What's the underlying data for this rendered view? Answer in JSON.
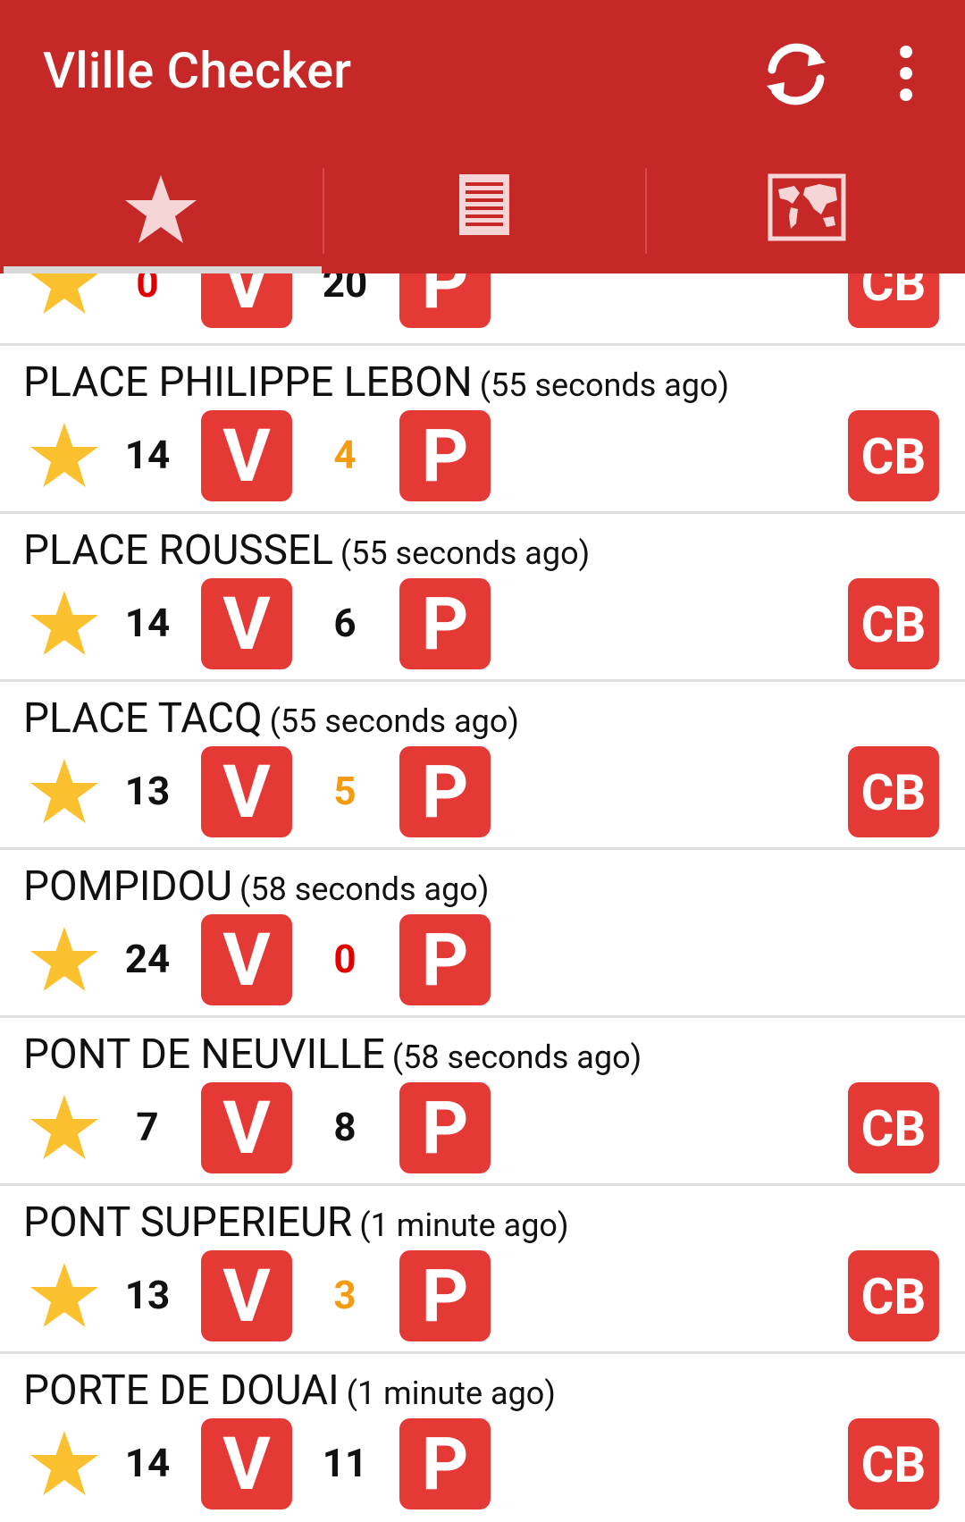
{
  "app": {
    "title": "Vlille Checker"
  },
  "toolbar": {
    "refresh_icon": "refresh-icon",
    "menu_icon": "more-vert-icon"
  },
  "tabs": [
    {
      "icon": "star-icon",
      "selected": true
    },
    {
      "icon": "list-icon",
      "selected": false
    },
    {
      "icon": "map-icon",
      "selected": false
    }
  ],
  "partial_row": {
    "bikes": "0",
    "stands": "20",
    "has_cb": true
  },
  "stations": [
    {
      "name": "PLACE PHILIPPE LEBON",
      "ago": "(55 seconds ago)",
      "bikes": "14",
      "stands": "4",
      "has_cb": true
    },
    {
      "name": "PLACE ROUSSEL",
      "ago": "(55 seconds ago)",
      "bikes": "14",
      "stands": "6",
      "has_cb": true
    },
    {
      "name": "PLACE TACQ",
      "ago": "(55 seconds ago)",
      "bikes": "13",
      "stands": "5",
      "has_cb": true
    },
    {
      "name": "POMPIDOU",
      "ago": "(58 seconds ago)",
      "bikes": "24",
      "stands": "0",
      "has_cb": false
    },
    {
      "name": "PONT DE NEUVILLE",
      "ago": "(58 seconds ago)",
      "bikes": "7",
      "stands": "8",
      "has_cb": true
    },
    {
      "name": "PONT SUPERIEUR",
      "ago": "(1 minute ago)",
      "bikes": "13",
      "stands": "3",
      "has_cb": true
    },
    {
      "name": "PORTE DE DOUAI",
      "ago": "(1 minute ago)",
      "bikes": "14",
      "stands": "11",
      "has_cb": true
    }
  ],
  "labels": {
    "bikes_badge": "V",
    "stands_badge": "P",
    "card_badge": "CB"
  },
  "colors": {
    "appbar": "#c62828",
    "badge": "#e53935",
    "star": "#fbc02d",
    "count_ok": "#111111",
    "count_low": "#f39c12",
    "count_zero": "#e00000"
  }
}
